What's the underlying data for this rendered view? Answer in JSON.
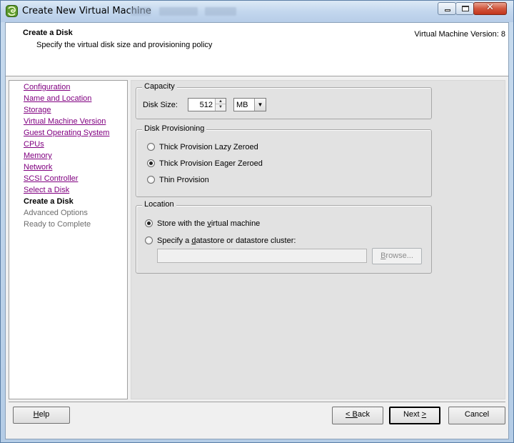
{
  "window": {
    "title": "Create New Virtual Machine",
    "icon": "vsphere-icon"
  },
  "header": {
    "title": "Create a Disk",
    "subtitle": "Specify the virtual disk size and provisioning policy",
    "version": "Virtual Machine Version: 8"
  },
  "nav": {
    "items": [
      {
        "label": "Configuration",
        "state": "link"
      },
      {
        "label": "Name and Location",
        "state": "link"
      },
      {
        "label": "Storage",
        "state": "link"
      },
      {
        "label": "Virtual Machine Version",
        "state": "link"
      },
      {
        "label": "Guest Operating System",
        "state": "link"
      },
      {
        "label": "CPUs",
        "state": "link"
      },
      {
        "label": "Memory",
        "state": "link"
      },
      {
        "label": "Network",
        "state": "link"
      },
      {
        "label": "SCSI Controller",
        "state": "link"
      },
      {
        "label": "Select a Disk",
        "state": "link"
      },
      {
        "label": "Create a Disk",
        "state": "current"
      },
      {
        "label": "Advanced Options",
        "state": "pending"
      },
      {
        "label": "Ready to Complete",
        "state": "pending"
      }
    ]
  },
  "capacity": {
    "legend": "Capacity",
    "disk_size_label": "Disk Size:",
    "disk_size_value": "512",
    "unit": "MB"
  },
  "provisioning": {
    "legend": "Disk Provisioning",
    "options": [
      {
        "label": "Thick Provision Lazy Zeroed",
        "checked": false
      },
      {
        "label": "Thick Provision Eager Zeroed",
        "checked": true
      },
      {
        "label": "Thin Provision",
        "checked": false
      }
    ]
  },
  "location": {
    "legend": "Location",
    "store_with_vm_pre": "Store with the ",
    "store_with_vm_u": "v",
    "store_with_vm_post": "irtual machine",
    "specify_pre": "Specify a ",
    "specify_u": "d",
    "specify_post": "atastore or datastore cluster:",
    "datastore_value": "",
    "browse_u": "B",
    "browse_rest": "rowse..."
  },
  "buttons": {
    "help_u": "H",
    "help_rest": "elp",
    "back_lt": "< ",
    "back_u": "B",
    "back_rest": "ack",
    "next_pre": "Next ",
    "next_u": ">",
    "cancel": "Cancel"
  },
  "colors": {
    "link": "#800080",
    "pending": "#6d6d6d",
    "content_bg": "#e2e2e2"
  }
}
